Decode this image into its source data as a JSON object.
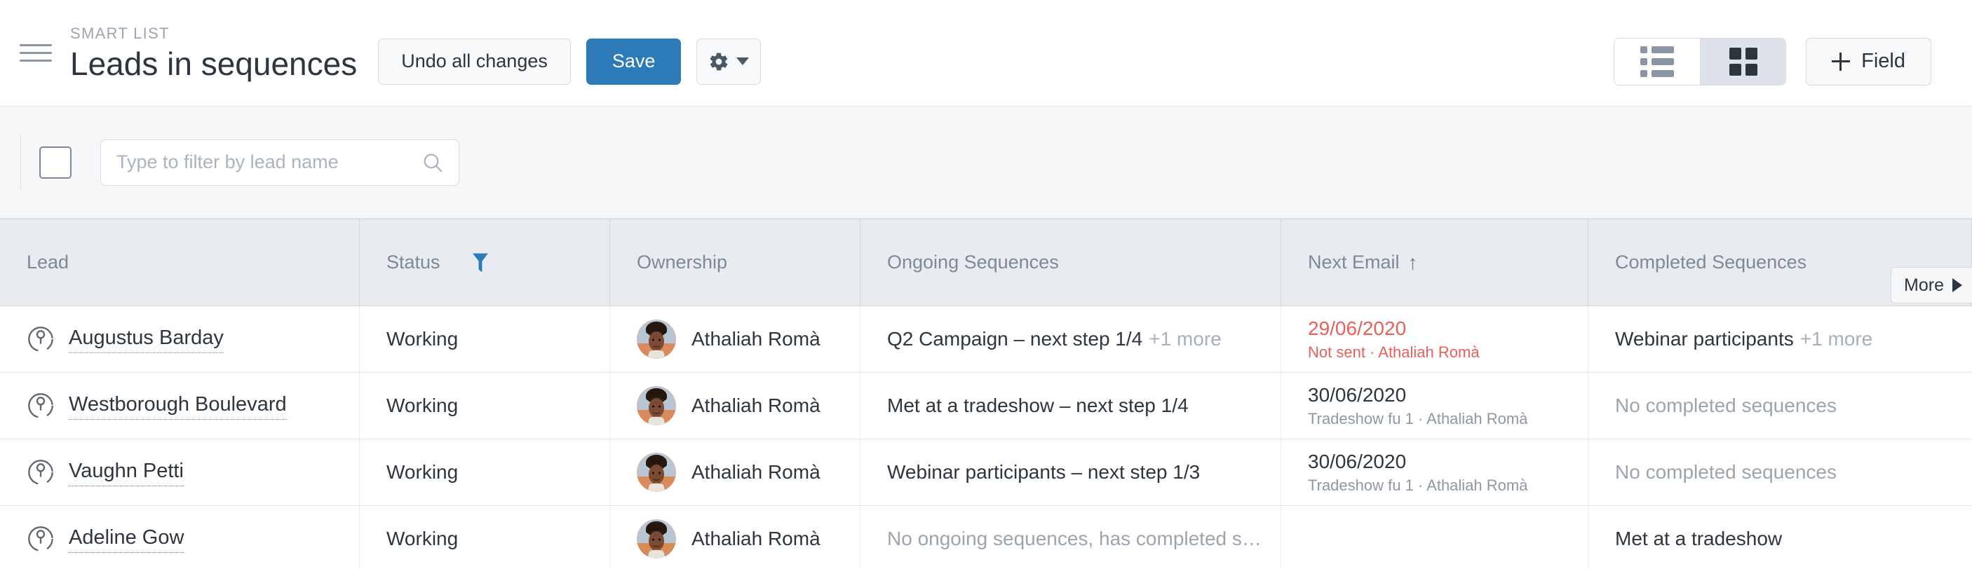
{
  "header": {
    "menu_icon": "hamburger-icon",
    "eyebrow": "SMART LIST",
    "title": "Leads in sequences",
    "undo_label": "Undo all changes",
    "save_label": "Save",
    "gear_icon": "gear-icon",
    "caret_icon": "caret-down-icon",
    "view_list_icon": "list-view-icon",
    "view_grid_icon": "grid-view-icon",
    "active_view": "grid",
    "add_field_label": "Field",
    "plus_icon": "plus-icon"
  },
  "filterbar": {
    "select_all_icon": "checkbox-unchecked-icon",
    "search_placeholder": "Type to filter by lead name",
    "search_value": "",
    "search_icon": "search-icon"
  },
  "table": {
    "columns": [
      {
        "key": "lead",
        "label": "Lead"
      },
      {
        "key": "status",
        "label": "Status",
        "filtered": true,
        "filter_icon": "filter-funnel-icon"
      },
      {
        "key": "ownership",
        "label": "Ownership"
      },
      {
        "key": "ongoing",
        "label": "Ongoing Sequences"
      },
      {
        "key": "next",
        "label": "Next Email",
        "sort": "asc",
        "sort_icon": "↑"
      },
      {
        "key": "completed",
        "label": "Completed Sequences"
      }
    ],
    "more_label": "More",
    "more_icon": "triangle-right-icon",
    "rows": [
      {
        "lead": "Augustus Barday",
        "lead_icon": "lead-circle-icon",
        "status": "Working",
        "owner": "Athaliah Romà",
        "owner_avatar": "avatar",
        "ongoing": "Q2 Campaign – next step 1/4",
        "ongoing_more": "+1 more",
        "ongoing_muted": false,
        "next_date": "29/06/2020",
        "next_sub": "Not sent · Athaliah Romà",
        "next_alert": true,
        "completed": "Webinar participants",
        "completed_more": "+1 more",
        "completed_muted": false
      },
      {
        "lead": "Westborough Boulevard",
        "lead_icon": "lead-circle-icon",
        "status": "Working",
        "owner": "Athaliah Romà",
        "owner_avatar": "avatar",
        "ongoing": "Met at a tradeshow – next step 1/4",
        "ongoing_more": "",
        "ongoing_muted": false,
        "next_date": "30/06/2020",
        "next_sub": "Tradeshow fu 1 · Athaliah Romà",
        "next_alert": false,
        "completed": "No completed sequences",
        "completed_more": "",
        "completed_muted": true
      },
      {
        "lead": "Vaughn Petti",
        "lead_icon": "lead-circle-icon",
        "status": "Working",
        "owner": "Athaliah Romà",
        "owner_avatar": "avatar",
        "ongoing": "Webinar participants – next step 1/3",
        "ongoing_more": "",
        "ongoing_muted": false,
        "next_date": "30/06/2020",
        "next_sub": "Tradeshow fu 1 · Athaliah Romà",
        "next_alert": false,
        "completed": "No completed sequences",
        "completed_more": "",
        "completed_muted": true
      },
      {
        "lead": "Adeline Gow",
        "lead_icon": "lead-circle-icon",
        "status": "Working",
        "owner": "Athaliah Romà",
        "owner_avatar": "avatar",
        "ongoing": "No ongoing sequences, has completed s…",
        "ongoing_more": "",
        "ongoing_muted": true,
        "next_date": "",
        "next_sub": "",
        "next_alert": false,
        "completed": "Met at a tradeshow",
        "completed_more": "",
        "completed_muted": false
      }
    ]
  },
  "colors": {
    "primary": "#2d7ab8",
    "alert": "#e8605a",
    "header_bg": "#e8ecf0",
    "filter_bg": "#f5f7f9",
    "text": "#2b3640",
    "muted": "#9aa5b0"
  }
}
